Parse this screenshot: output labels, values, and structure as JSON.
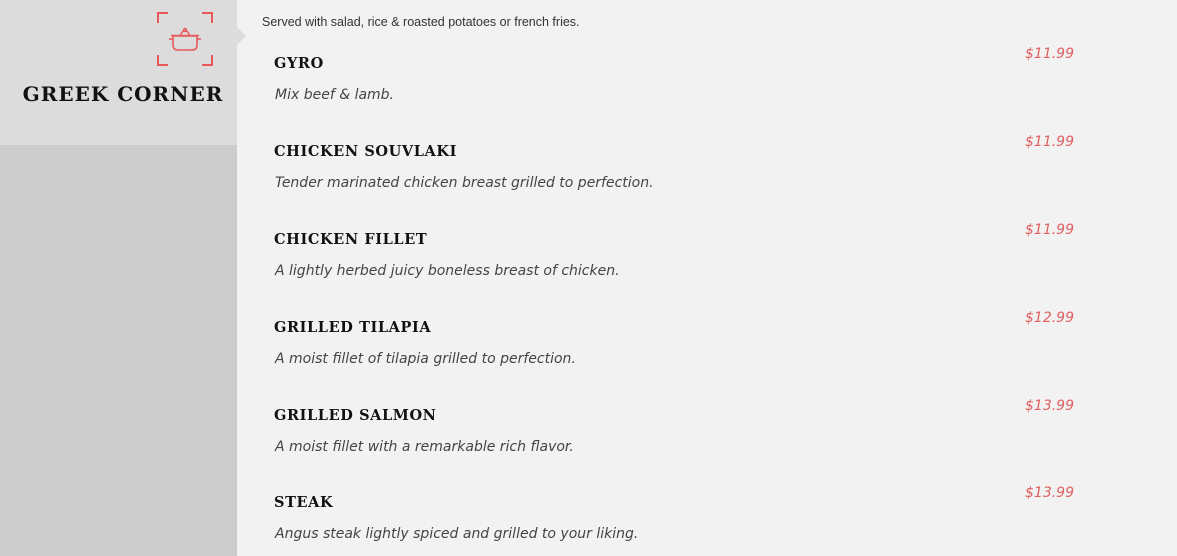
{
  "category": {
    "title": "GREEK CORNER",
    "icon": "pot-icon",
    "accent_color": "#e85a5a"
  },
  "intro": "Served with salad, rice & roasted potatoes or french fries.",
  "items": [
    {
      "name": "GYRO",
      "description": "Mix beef & lamb.",
      "price": "$11.99"
    },
    {
      "name": "CHICKEN SOUVLAKI",
      "description": "Tender marinated chicken breast grilled to perfection.",
      "price": "$11.99"
    },
    {
      "name": "CHICKEN FILLET",
      "description": "A lightly herbed juicy boneless breast of chicken.",
      "price": "$11.99"
    },
    {
      "name": "GRILLED TILAPIA",
      "description": "A moist fillet of tilapia grilled to perfection.",
      "price": "$12.99"
    },
    {
      "name": "GRILLED SALMON",
      "description": "A moist fillet with a remarkable rich flavor.",
      "price": "$13.99"
    },
    {
      "name": "STEAK",
      "description": "Angus steak lightly spiced and grilled to your liking.",
      "price": "$13.99"
    }
  ]
}
